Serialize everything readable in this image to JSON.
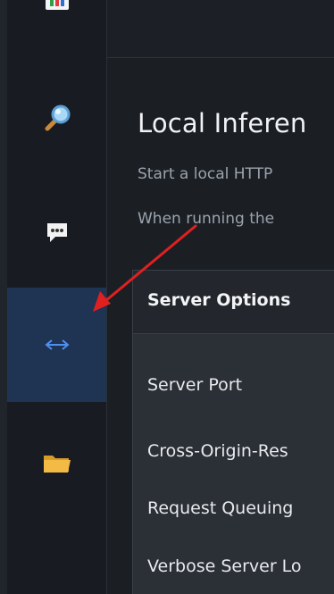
{
  "sidebar": {
    "items": [
      {
        "icon": "chart-icon"
      },
      {
        "icon": "search-icon"
      },
      {
        "icon": "chat-icon"
      },
      {
        "icon": "server-arrows-icon",
        "active": true
      },
      {
        "icon": "folder-icon"
      }
    ]
  },
  "main": {
    "title": "Local Inferen",
    "description_line1": "Start a local HTTP",
    "description_line2": "When running the"
  },
  "server_panel": {
    "header": "Server Options",
    "options": [
      "Server Port",
      "Cross-Origin-Res",
      "Request Queuing",
      "Verbose Server Lo"
    ]
  },
  "annotation": {
    "arrow_color": "#e02020"
  }
}
